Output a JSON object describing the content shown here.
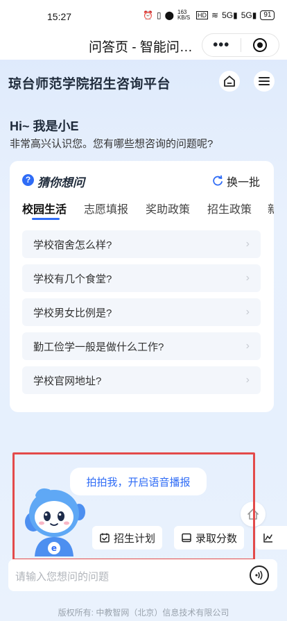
{
  "status_bar": {
    "time": "15:27",
    "net_speed": "163 KB/S",
    "hd_label": "HD",
    "signal_1": "5G",
    "signal_2": "5G",
    "battery": "91"
  },
  "nav_bar": {
    "title": "问答页 - 智能问…",
    "more_icon": "more-dots-icon",
    "close_icon": "target-circle-icon"
  },
  "header": {
    "brand": "琼台师范学院招生咨询平台",
    "home_icon": "home-icon",
    "menu_icon": "menu-icon"
  },
  "greeting": {
    "title": "Hi~ 我是小E",
    "subtitle": "非常高兴认识您。您有哪些想咨询的问题呢?"
  },
  "guess_card": {
    "title": "猜你想问",
    "refresh_label": "换一批",
    "tabs": [
      {
        "label": "校园生活",
        "active": true
      },
      {
        "label": "志愿填报",
        "active": false
      },
      {
        "label": "奖助政策",
        "active": false
      },
      {
        "label": "招生政策",
        "active": false
      },
      {
        "label": "新",
        "active": false
      }
    ],
    "questions": [
      "学校宿舍怎么样?",
      "学校有几个食堂?",
      "学校男女比例是?",
      "勤工俭学一般是做什么工作?",
      "学校官网地址?"
    ]
  },
  "assistant": {
    "bubble": "拍拍我，开启语音播报",
    "mascot_badge": "e"
  },
  "quick_chips": [
    {
      "label": "招生计划",
      "icon": "calendar-check-icon"
    },
    {
      "label": "录取分数",
      "icon": "book-icon"
    },
    {
      "label": "",
      "icon": "chart-icon"
    }
  ],
  "input": {
    "placeholder": "请输入您想问的问题"
  },
  "footer": {
    "copyright": "版权所有: 中教智网（北京）信息技术有限公司"
  },
  "colors": {
    "accent": "#2f6cf6",
    "highlight": "#e34a4a"
  }
}
